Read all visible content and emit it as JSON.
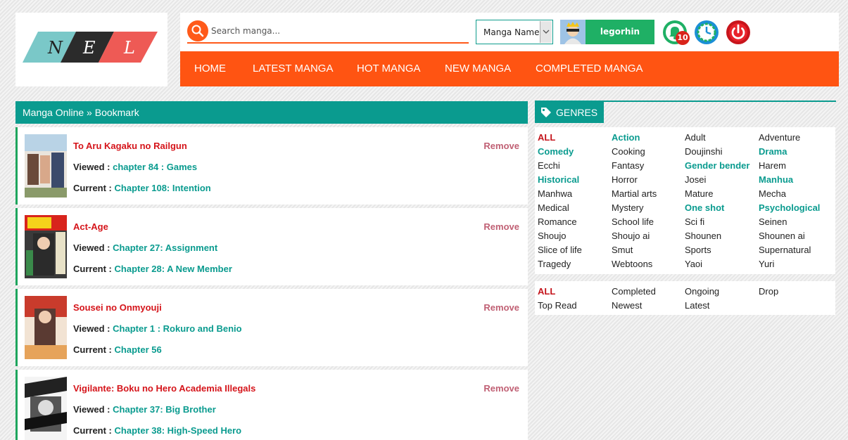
{
  "logo": {
    "letters": [
      "N",
      "E",
      "L"
    ]
  },
  "header": {
    "search": {
      "placeholder": "Search manga...",
      "value": ""
    },
    "search_type": "Manga Name",
    "username": "legorhin",
    "notification_count": "10"
  },
  "nav": [
    "HOME",
    "LATEST MANGA",
    "HOT MANGA",
    "NEW MANGA",
    "COMPLETED MANGA"
  ],
  "breadcrumb": "Manga Online » Bookmark",
  "bookmarks": [
    {
      "title": "To Aru Kagaku no Railgun",
      "remove": "Remove",
      "viewed_label": "Viewed :",
      "viewed": "chapter 84 : Games",
      "current_label": "Current :",
      "current": "Chapter 108: Intention"
    },
    {
      "title": "Act-Age",
      "remove": "Remove",
      "viewed_label": "Viewed :",
      "viewed": "Chapter 27: Assignment",
      "current_label": "Current :",
      "current": "Chapter 28: A New Member"
    },
    {
      "title": "Sousei no Onmyouji",
      "remove": "Remove",
      "viewed_label": "Viewed :",
      "viewed": "Chapter 1 : Rokuro and Benio",
      "current_label": "Current :",
      "current": "Chapter 56"
    },
    {
      "title": "Vigilante: Boku no Hero Academia Illegals",
      "remove": "Remove",
      "viewed_label": "Viewed :",
      "viewed": "Chapter 37: Big Brother",
      "current_label": "Current :",
      "current": "Chapter 38: High-Speed Hero"
    }
  ],
  "genres": {
    "heading": "GENRES",
    "items": [
      "ALL",
      "Action",
      "Adult",
      "Adventure",
      "Comedy",
      "Cooking",
      "Doujinshi",
      "Drama",
      "Ecchi",
      "Fantasy",
      "Gender bender",
      "Harem",
      "Historical",
      "Horror",
      "Josei",
      "Manhua",
      "Manhwa",
      "Martial arts",
      "Mature",
      "Mecha",
      "Medical",
      "Mystery",
      "One shot",
      "Psychological",
      "Romance",
      "School life",
      "Sci fi",
      "Seinen",
      "Shoujo",
      "Shoujo ai",
      "Shounen",
      "Shounen ai",
      "Slice of life",
      "Smut",
      "Sports",
      "Supernatural",
      "Tragedy",
      "Webtoons",
      "Yaoi",
      "Yuri"
    ],
    "status_items": [
      "ALL",
      "Completed",
      "Ongoing",
      "Drop",
      "Top Read",
      "Newest",
      "Latest"
    ]
  },
  "colors": {
    "accent_orange": "#ff5412",
    "teal": "#0a9b8f",
    "green": "#1ea55d",
    "title_red": "#d5141a"
  }
}
